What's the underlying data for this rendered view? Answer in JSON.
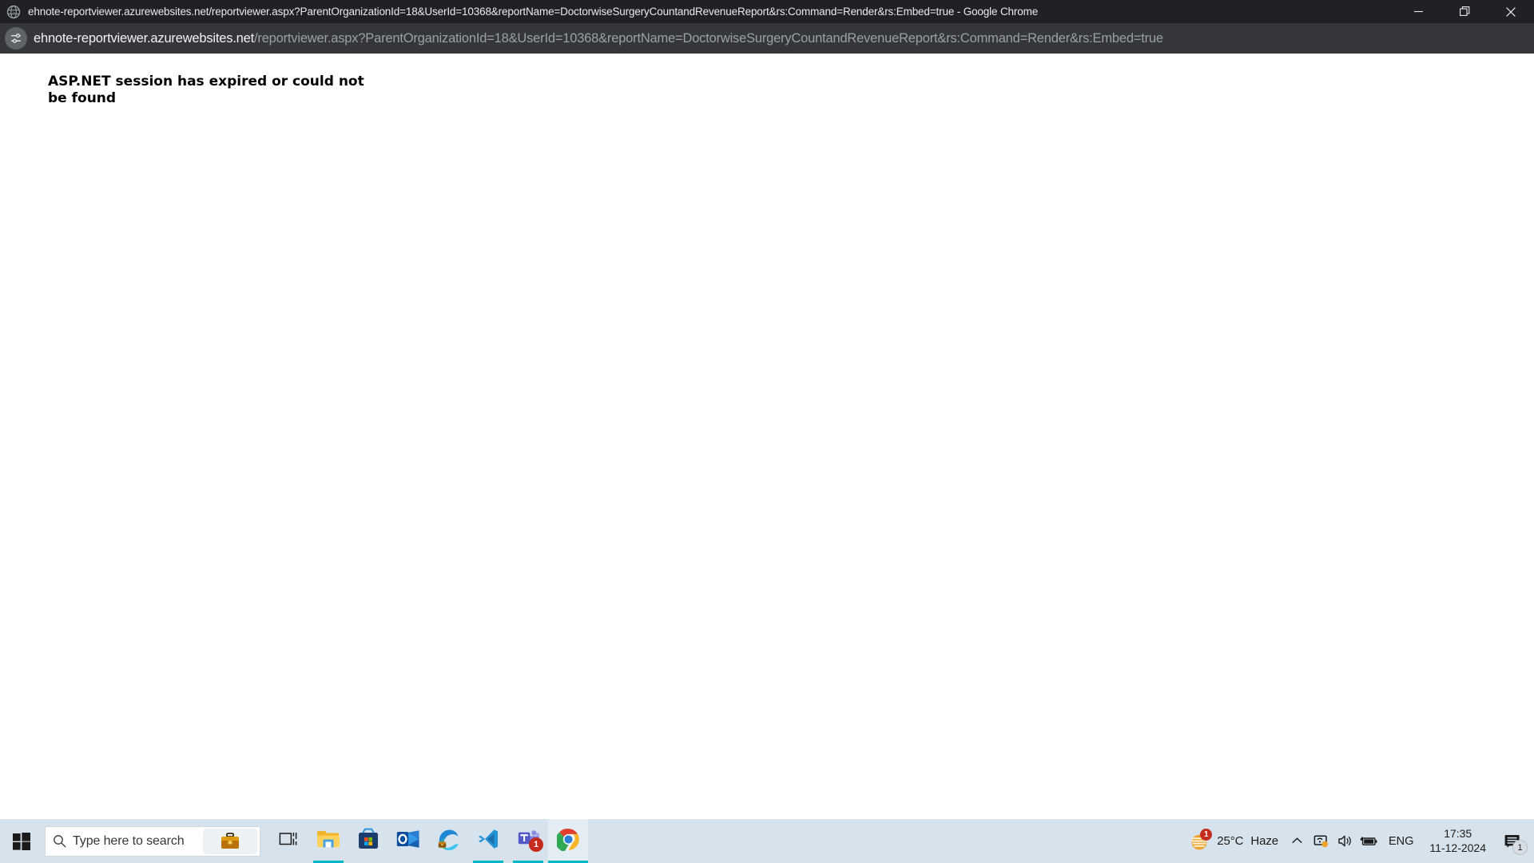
{
  "browser": {
    "window_title": "ehnote-reportviewer.azurewebsites.net/reportviewer.aspx?ParentOrganizationId=18&UserId=10368&reportName=DoctorwiseSurgeryCountandRevenueReport&rs:Command=Render&rs:Embed=true - Google Chrome",
    "favicon": "globe-icon",
    "window_controls": {
      "minimize": "—",
      "restore": "❐",
      "close": "✕"
    },
    "omnibox": {
      "site_settings_icon": "tune-sliders-icon",
      "url_domain": "ehnote-reportviewer.azurewebsites.net",
      "url_path": "/reportviewer.aspx?ParentOrganizationId=18&UserId=10368&reportName=DoctorwiseSurgeryCountandRevenueReport&rs:Command=Render&rs:Embed=true"
    }
  },
  "page": {
    "error_message": "ASP.NET session has expired or could not be found"
  },
  "taskbar": {
    "start_label": "start-icon",
    "search": {
      "placeholder": "Type here to search",
      "icon": "search-icon",
      "widget_icon": "briefcase-icon"
    },
    "apps": [
      {
        "name": "task-view",
        "label": "Task View",
        "state": "idle",
        "badge": ""
      },
      {
        "name": "file-explorer",
        "label": "File Explorer",
        "state": "running",
        "badge": ""
      },
      {
        "name": "microsoft-store",
        "label": "Microsoft Store",
        "state": "idle",
        "badge": ""
      },
      {
        "name": "outlook",
        "label": "Outlook",
        "state": "idle",
        "badge": ""
      },
      {
        "name": "microsoft-edge",
        "label": "Microsoft Edge",
        "state": "idle",
        "badge": ""
      },
      {
        "name": "vs-code",
        "label": "Visual Studio Code",
        "state": "running",
        "badge": ""
      },
      {
        "name": "microsoft-teams",
        "label": "Microsoft Teams",
        "state": "running",
        "badge": "1"
      },
      {
        "name": "google-chrome",
        "label": "Google Chrome",
        "state": "active",
        "badge": ""
      }
    ],
    "tray": {
      "weather_temp": "25°C",
      "weather_condition": "Haze",
      "weather_badge": "1",
      "show_hidden_icons": "chevron-up-icon",
      "network_icon": "network-warning-icon",
      "volume_icon": "speaker-icon",
      "battery_icon": "battery-charging-icon",
      "language": "ENG",
      "time": "17:35",
      "date": "11-12-2024",
      "notifications_badge": "1"
    }
  },
  "colors": {
    "titlebar_bg": "#202124",
    "toolbar_bg": "#35363a",
    "url_domain_color": "#f1f3f4",
    "url_path_color": "#9aa0a6",
    "page_bg": "#ffffff",
    "taskbar_bg": "#d6e3ed",
    "accent_underline": "#00b7c3",
    "badge_red": "#c42b1c"
  }
}
